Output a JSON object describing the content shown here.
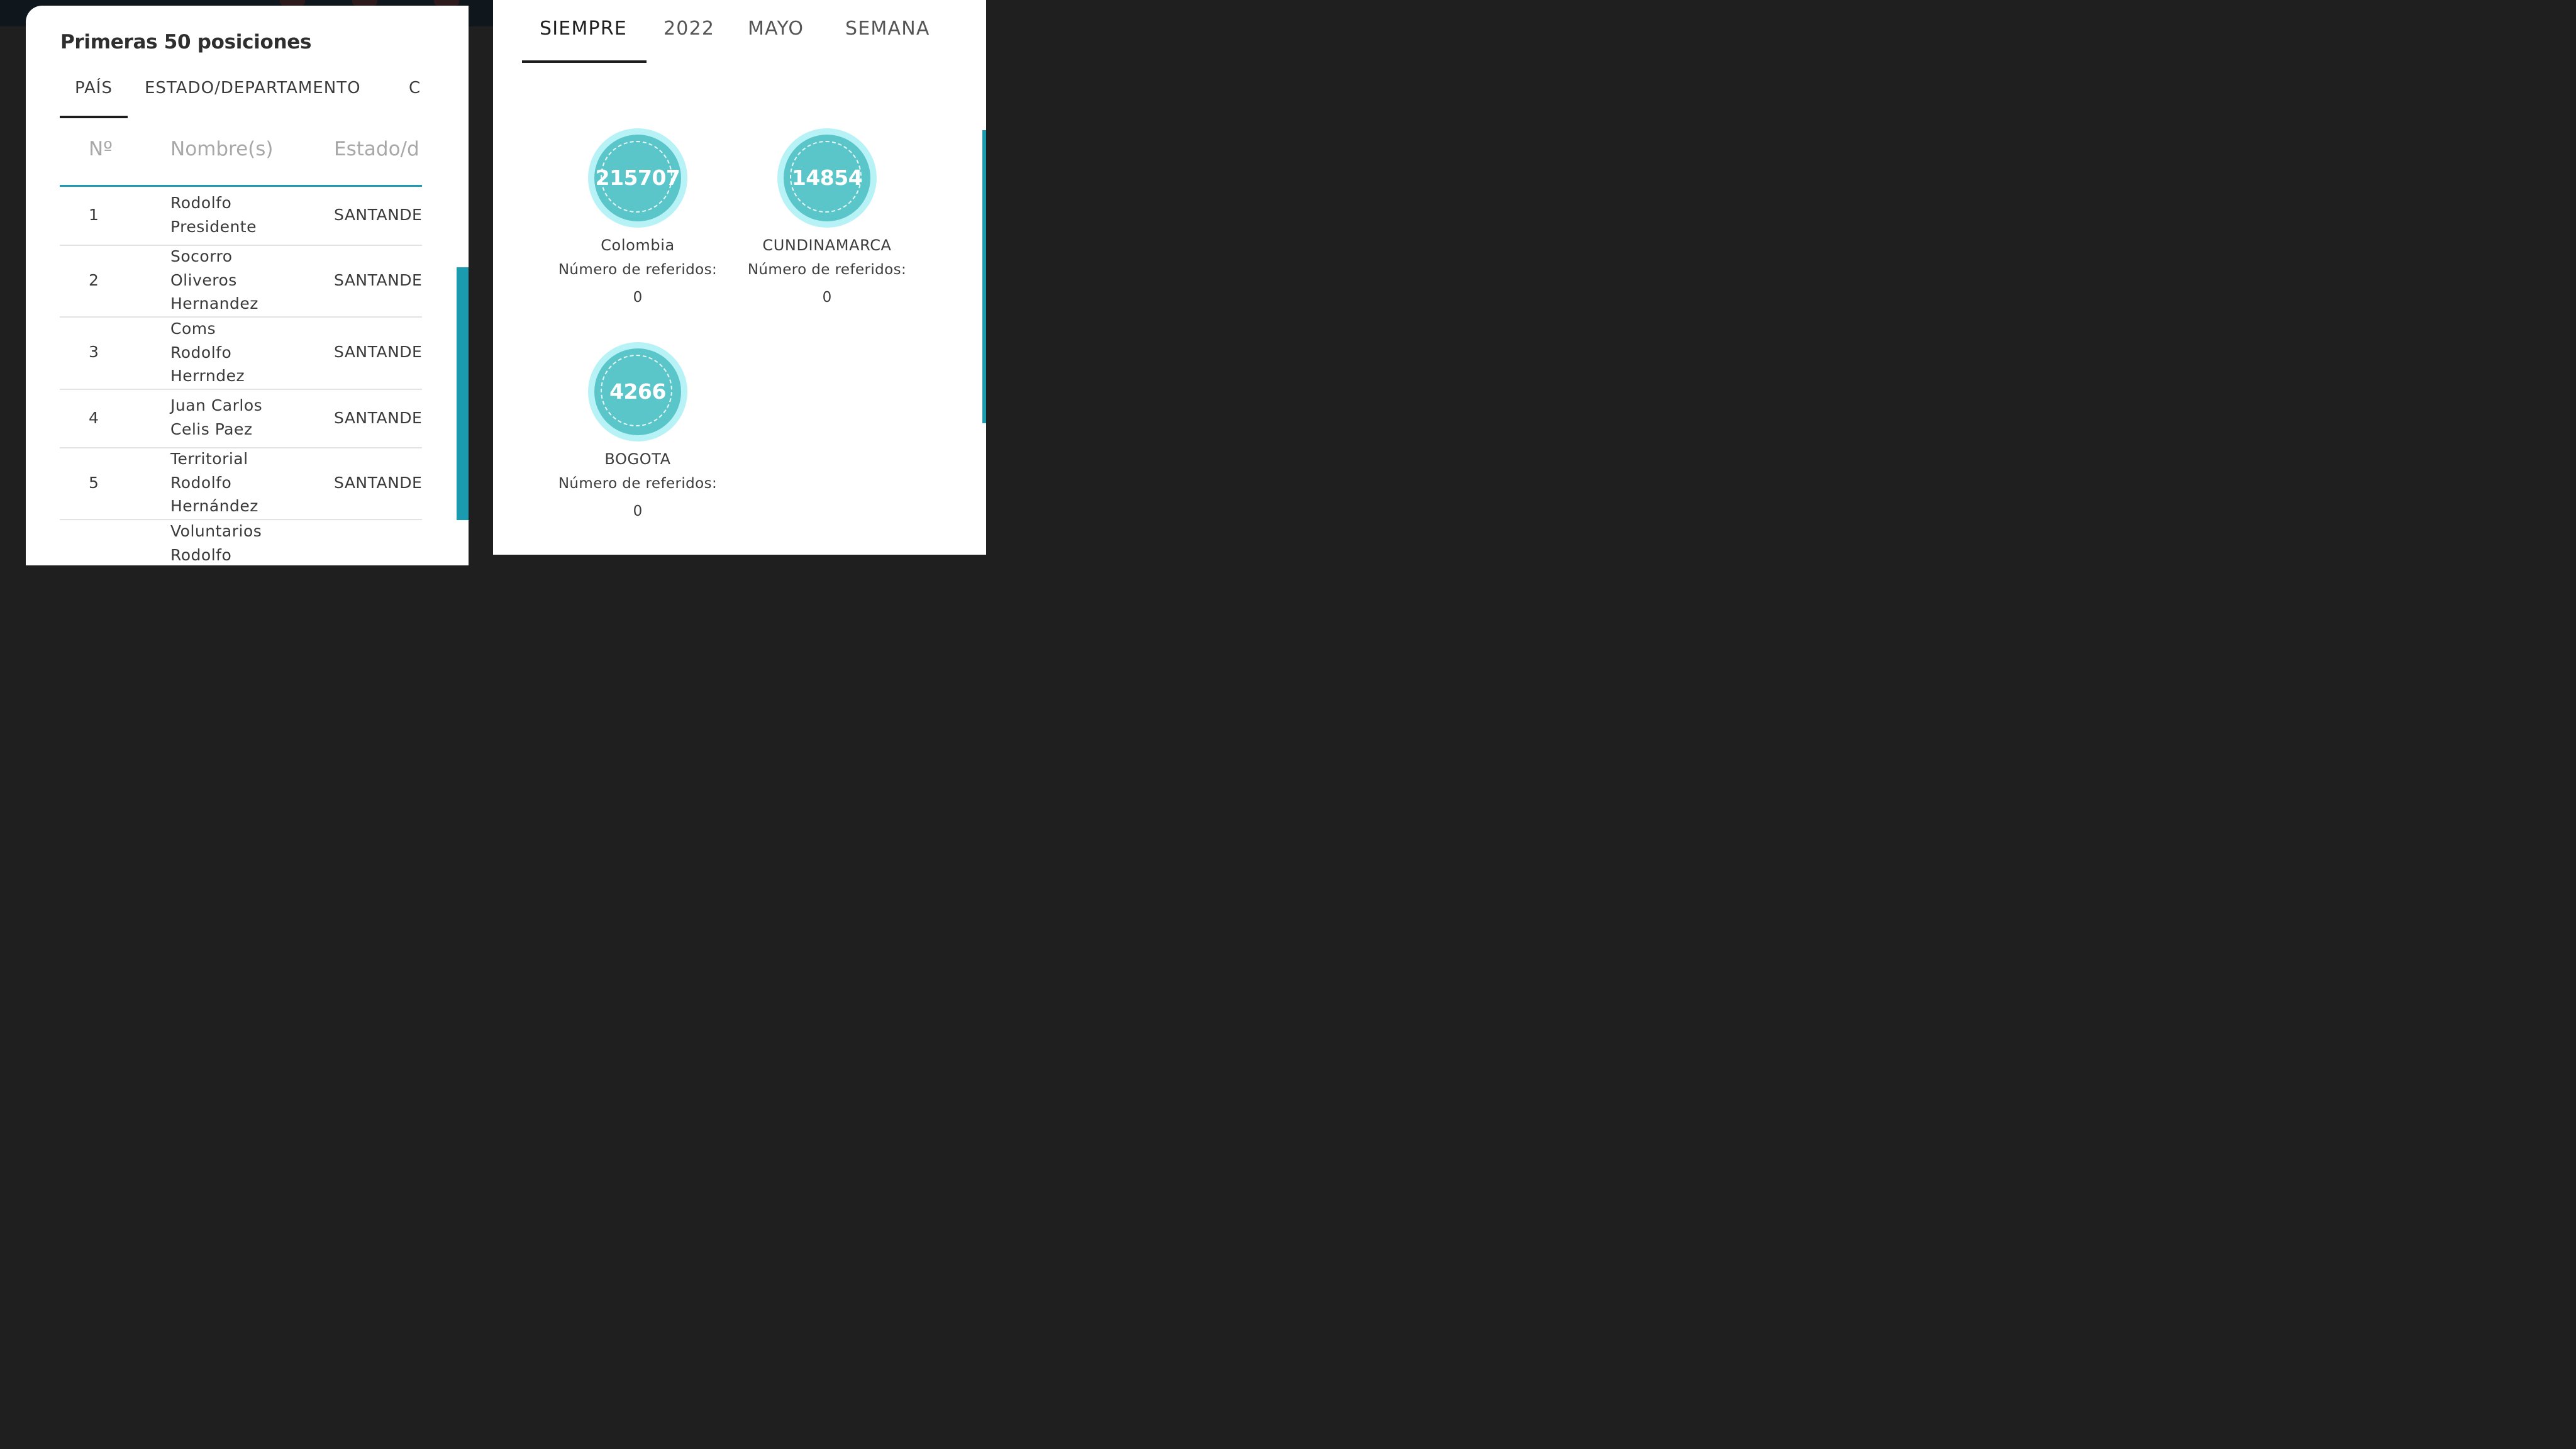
{
  "modal": {
    "title": "Primeras 50 posiciones",
    "tabs": [
      "PAÍS",
      "ESTADO/DEPARTAMENTO",
      "C"
    ],
    "table": {
      "headers": [
        "Nº",
        "Nombre(s)",
        "Estado/d"
      ],
      "rows": [
        {
          "num": "1",
          "name": "Rodolfo Presidente",
          "state": "SANTANDE"
        },
        {
          "num": "2",
          "name": "Socorro Oliveros Hernandez",
          "state": "SANTANDE"
        },
        {
          "num": "3",
          "name": "Coms Rodolfo Herrndez",
          "state": "SANTANDE"
        },
        {
          "num": "4",
          "name": "Juan Carlos Celis Paez",
          "state": "SANTANDE"
        },
        {
          "num": "5",
          "name": "Territorial Rodolfo Hernández",
          "state": "SANTANDE"
        },
        {
          "num": "",
          "name": "Voluntarios Rodolfo",
          "state": ""
        }
      ]
    }
  },
  "right": {
    "tabs": [
      "SIEMPRE",
      "2022",
      "MAYO",
      "SEMANA"
    ],
    "cards": [
      {
        "count": "215707",
        "name": "Colombia",
        "label": "Número de referidos:",
        "value": "0"
      },
      {
        "count": "14854",
        "name": "CUNDINAMARCA",
        "label": "Número de referidos:",
        "value": "0"
      },
      {
        "count": "4266",
        "name": "BOGOTA",
        "label": "Número de referidos:",
        "value": "0"
      }
    ]
  },
  "colors": {
    "accent": "#1a9bb0",
    "badge_fill": "#5bc6c9",
    "badge_ring": "#b7f3f6"
  }
}
